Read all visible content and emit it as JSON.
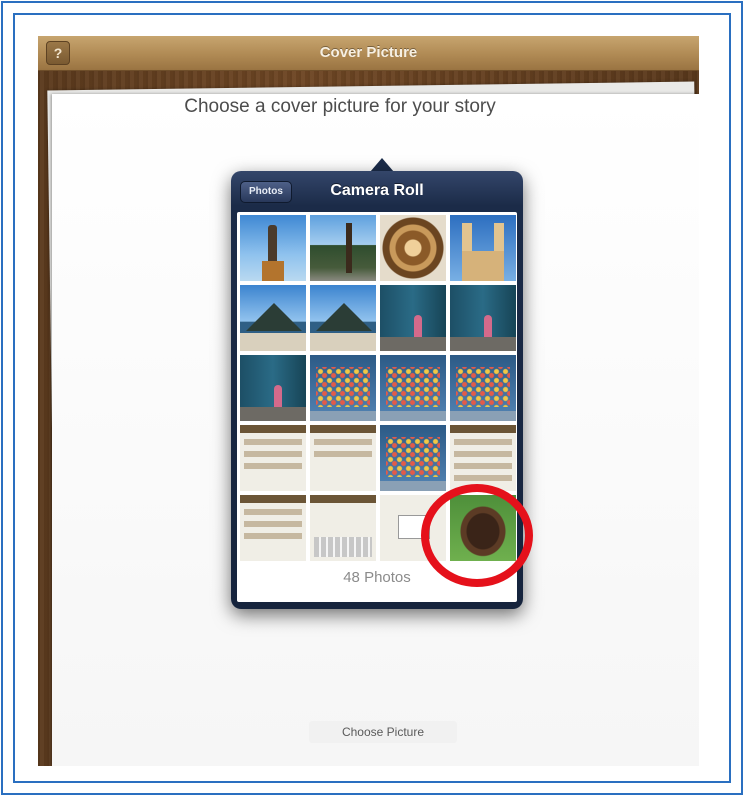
{
  "app": {
    "title": "Cover Picture",
    "help_label": "?",
    "prompt": "Choose a cover picture for your story",
    "choose_button": "Choose Picture"
  },
  "popover": {
    "back_label": "Photos",
    "title": "Camera Roll",
    "photo_count": "48 Photos",
    "selected_photo": "dog on grass",
    "highlight_color": "#e5111b"
  },
  "thumbnails": [
    "statue",
    "palm-trees",
    "carved-wood-rosette",
    "church-towers",
    "mountain-bay",
    "mountain-bay",
    "wall-figure",
    "wall-figure",
    "wall-figure",
    "ipad-homescreen",
    "ipad-homescreen",
    "ipad-homescreen",
    "app-screenshot",
    "app-screenshot",
    "ipad-homescreen",
    "app-screenshot",
    "app-screenshot",
    "keyboard-screenshot",
    "popup-screenshot",
    "dog-on-grass"
  ]
}
